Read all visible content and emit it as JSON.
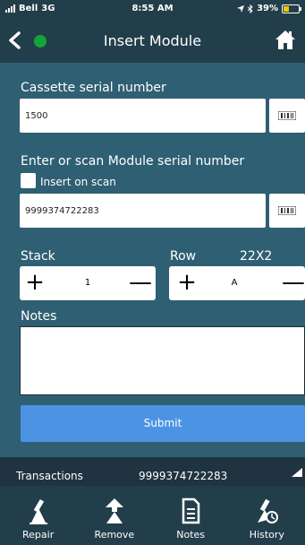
{
  "status_bar": {
    "carrier": "Bell",
    "network": "3G",
    "time": "8:55 AM",
    "battery": "39%",
    "battery_level": 0.39
  },
  "header": {
    "title": "Insert Module"
  },
  "cassette": {
    "label": "Cassette serial number",
    "value": "1500"
  },
  "module": {
    "label": "Enter or scan Module serial number",
    "insert_on_scan": "Insert on scan",
    "value": "9999374722283"
  },
  "stack": {
    "label": "Stack",
    "value": "1"
  },
  "row": {
    "label": "Row",
    "code": "22X2",
    "value": "A"
  },
  "notes": {
    "label": "Notes",
    "value": ""
  },
  "submit": {
    "label": "Submit"
  },
  "transactions": {
    "label": "Transactions",
    "value": "9999374722283"
  },
  "tabs": [
    {
      "label": "Repair",
      "icon": "repair-icon"
    },
    {
      "label": "Remove",
      "icon": "remove-icon"
    },
    {
      "label": "Notes",
      "icon": "notes-icon"
    },
    {
      "label": "History",
      "icon": "history-icon"
    }
  ],
  "colors": {
    "background": "#2f5f72",
    "bar": "#233e4b",
    "submit": "#4d93e4",
    "connection_dot": "#12a33a",
    "battery": "#f2c500"
  }
}
